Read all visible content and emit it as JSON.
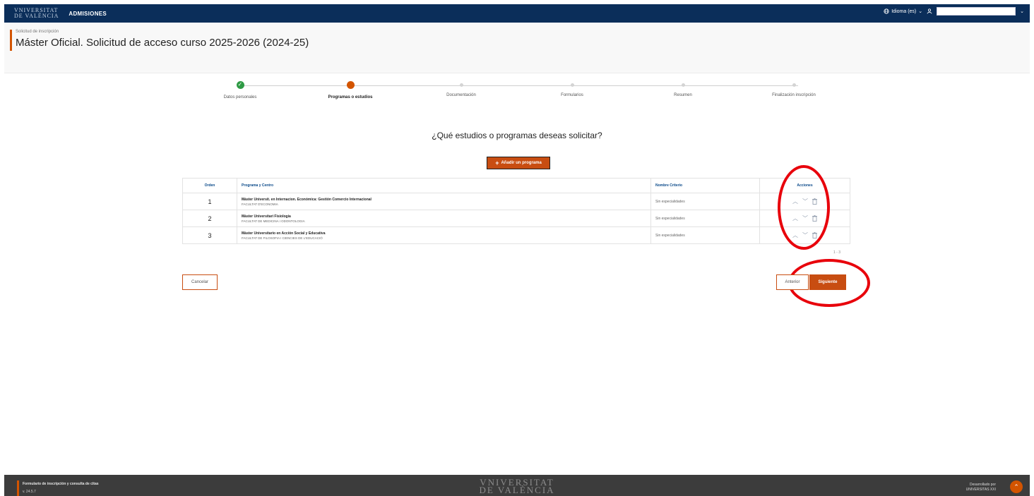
{
  "topbar": {
    "logo_line1": "VNIVERSITAT",
    "logo_line2": "DE VALÈNCIA",
    "app_name": "ADMISIONES",
    "language": "Idioma (es)",
    "globe_icon": "globe-icon",
    "user_icon": "user-icon"
  },
  "header": {
    "breadcrumb": "Solicitud de inscripción",
    "title": "Máster Oficial. Solicitud de acceso curso 2025-2026 (2024-25)"
  },
  "steps": [
    {
      "label": "Datos personales",
      "state": "done"
    },
    {
      "label": "Programas o estudios",
      "state": "current"
    },
    {
      "label": "Documentación",
      "state": "pending"
    },
    {
      "label": "Formularios",
      "state": "pending"
    },
    {
      "label": "Resumen",
      "state": "pending"
    },
    {
      "label": "Finalización inscripción",
      "state": "pending"
    }
  ],
  "main": {
    "question": "¿Qué estudios o programas deseas solicitar?",
    "add_button": "Añadir un programa"
  },
  "table": {
    "headers": {
      "order": "Orden",
      "program": "Programa y Centro",
      "criteria": "Nombre Criterio",
      "actions": "Acciones"
    },
    "rows": [
      {
        "order": "1",
        "name": "Màster Universit. en Internacion. Económica: Gestión Comercio Internacional",
        "center": "FACULTAT D'ECONOMIA",
        "criteria": "Sin especialidades"
      },
      {
        "order": "2",
        "name": "Màster Universitari Fisiologia",
        "center": "FACULTAT DE MEDICINA I ODONTOLOGIA",
        "criteria": "Sin especialidades"
      },
      {
        "order": "3",
        "name": "Màster Universitario en Acción Social y Educativa",
        "center": "FACULTAT DE FILOSOFIA I CIENCIES DE L'EDUCACIÓ",
        "criteria": "Sin especialidades"
      }
    ],
    "pager": "1 - 3"
  },
  "buttons": {
    "cancel": "Cancelar",
    "previous": "Anterior",
    "next": "Siguiente"
  },
  "footer": {
    "title": "Formulario de inscripción y consulta de citas",
    "version": "v. 24.5.7",
    "logo_line1": "VNIVERSITAT",
    "logo_line2": "DE VALÈNCIA",
    "developed_by": "Desarrollado por",
    "developer": "UNIVERSITAS XXI"
  },
  "colors": {
    "primary": "#c84d11",
    "navbar": "#0b2e5a",
    "success": "#2e9a44",
    "annotation": "#e8000b"
  }
}
